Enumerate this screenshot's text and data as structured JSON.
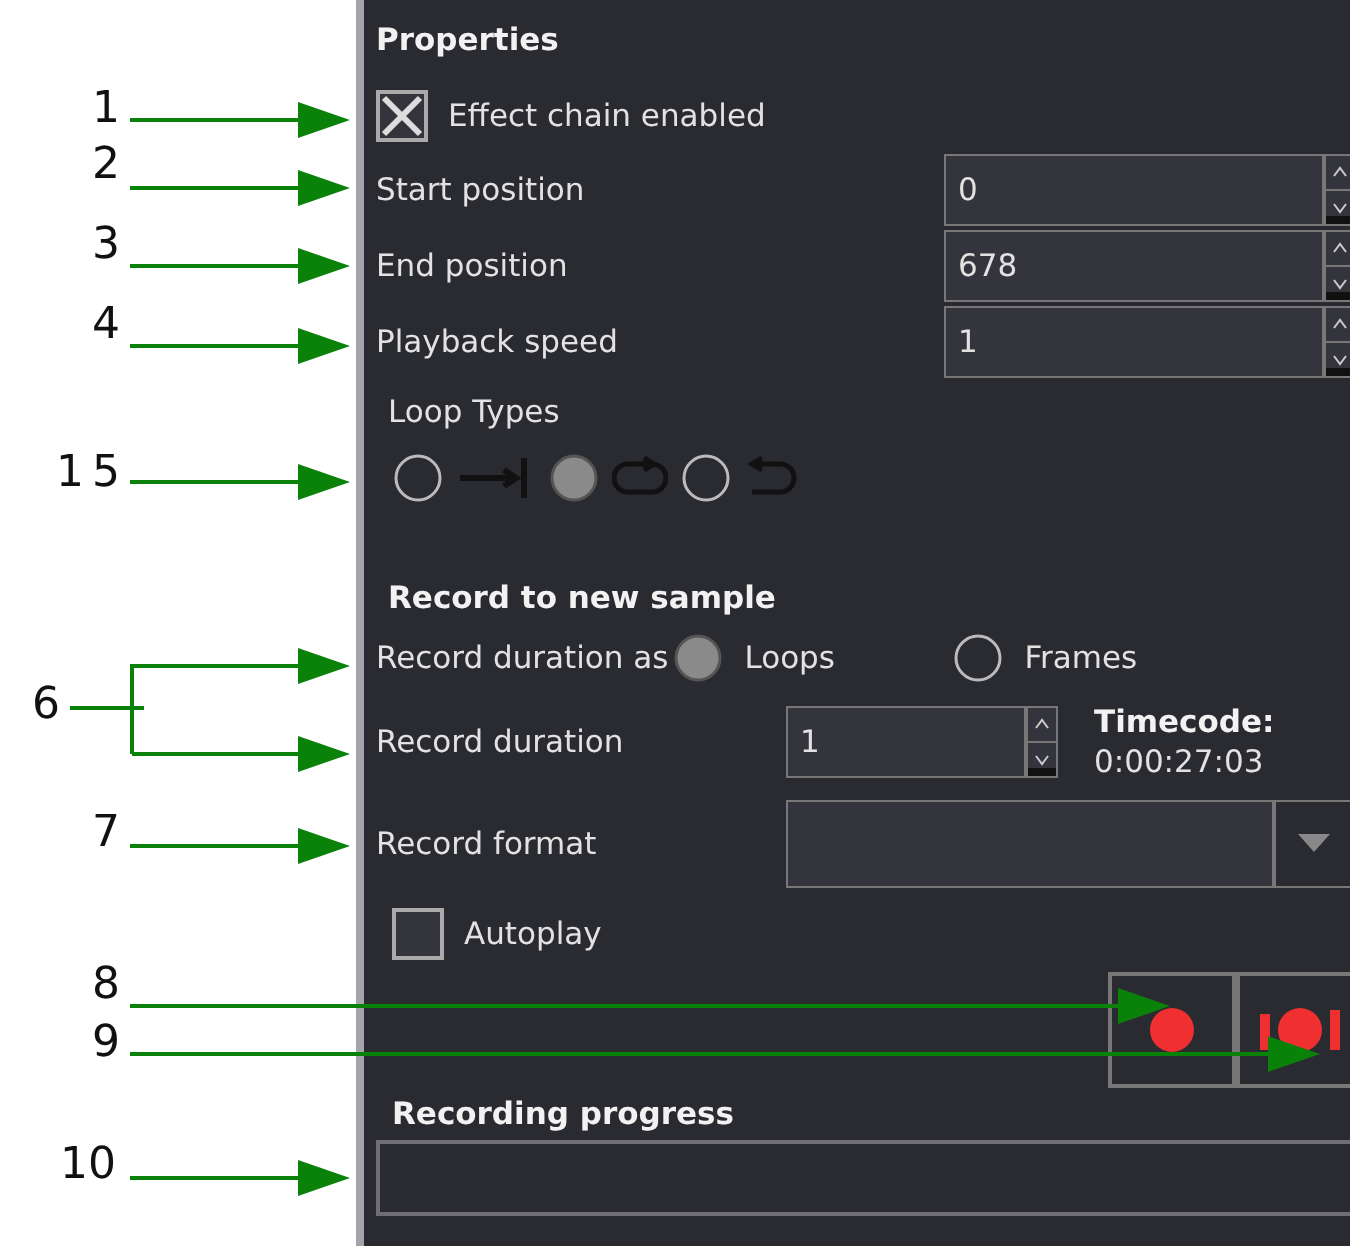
{
  "annotations": [
    {
      "label": "1"
    },
    {
      "label": "2"
    },
    {
      "label": "3"
    },
    {
      "label": "4"
    },
    {
      "label": "5",
      "overlay_label": "1"
    },
    {
      "label": "6"
    },
    {
      "label": "7"
    },
    {
      "label": "8"
    },
    {
      "label": "9"
    },
    {
      "label": "10"
    }
  ],
  "properties": {
    "title": "Properties",
    "effect_chain": {
      "label": "Effect chain enabled",
      "checked": true
    },
    "fields": [
      {
        "label": "Start position",
        "value": "0"
      },
      {
        "label": "End position",
        "value": "678"
      },
      {
        "label": "Playback speed",
        "value": "1"
      }
    ],
    "loop_types": {
      "title": "Loop Types",
      "options": [
        {
          "kind": "once",
          "selected": false
        },
        {
          "kind": "loop",
          "selected": true
        },
        {
          "kind": "pingpong",
          "selected": false
        }
      ]
    }
  },
  "record": {
    "title": "Record to new sample",
    "duration_as": {
      "label": "Record duration as",
      "options": [
        {
          "label": "Loops",
          "selected": true
        },
        {
          "label": "Frames",
          "selected": false
        }
      ]
    },
    "duration": {
      "label": "Record duration",
      "value": "1"
    },
    "timecode": {
      "label": "Timecode:",
      "value": "0:00:27:03"
    },
    "format": {
      "label": "Record format"
    },
    "autoplay": {
      "label": "Autoplay",
      "checked": false
    },
    "buttons": [
      {
        "kind": "record"
      },
      {
        "kind": "record_between"
      }
    ]
  },
  "progress": {
    "title": "Recording progress",
    "level": 0
  }
}
